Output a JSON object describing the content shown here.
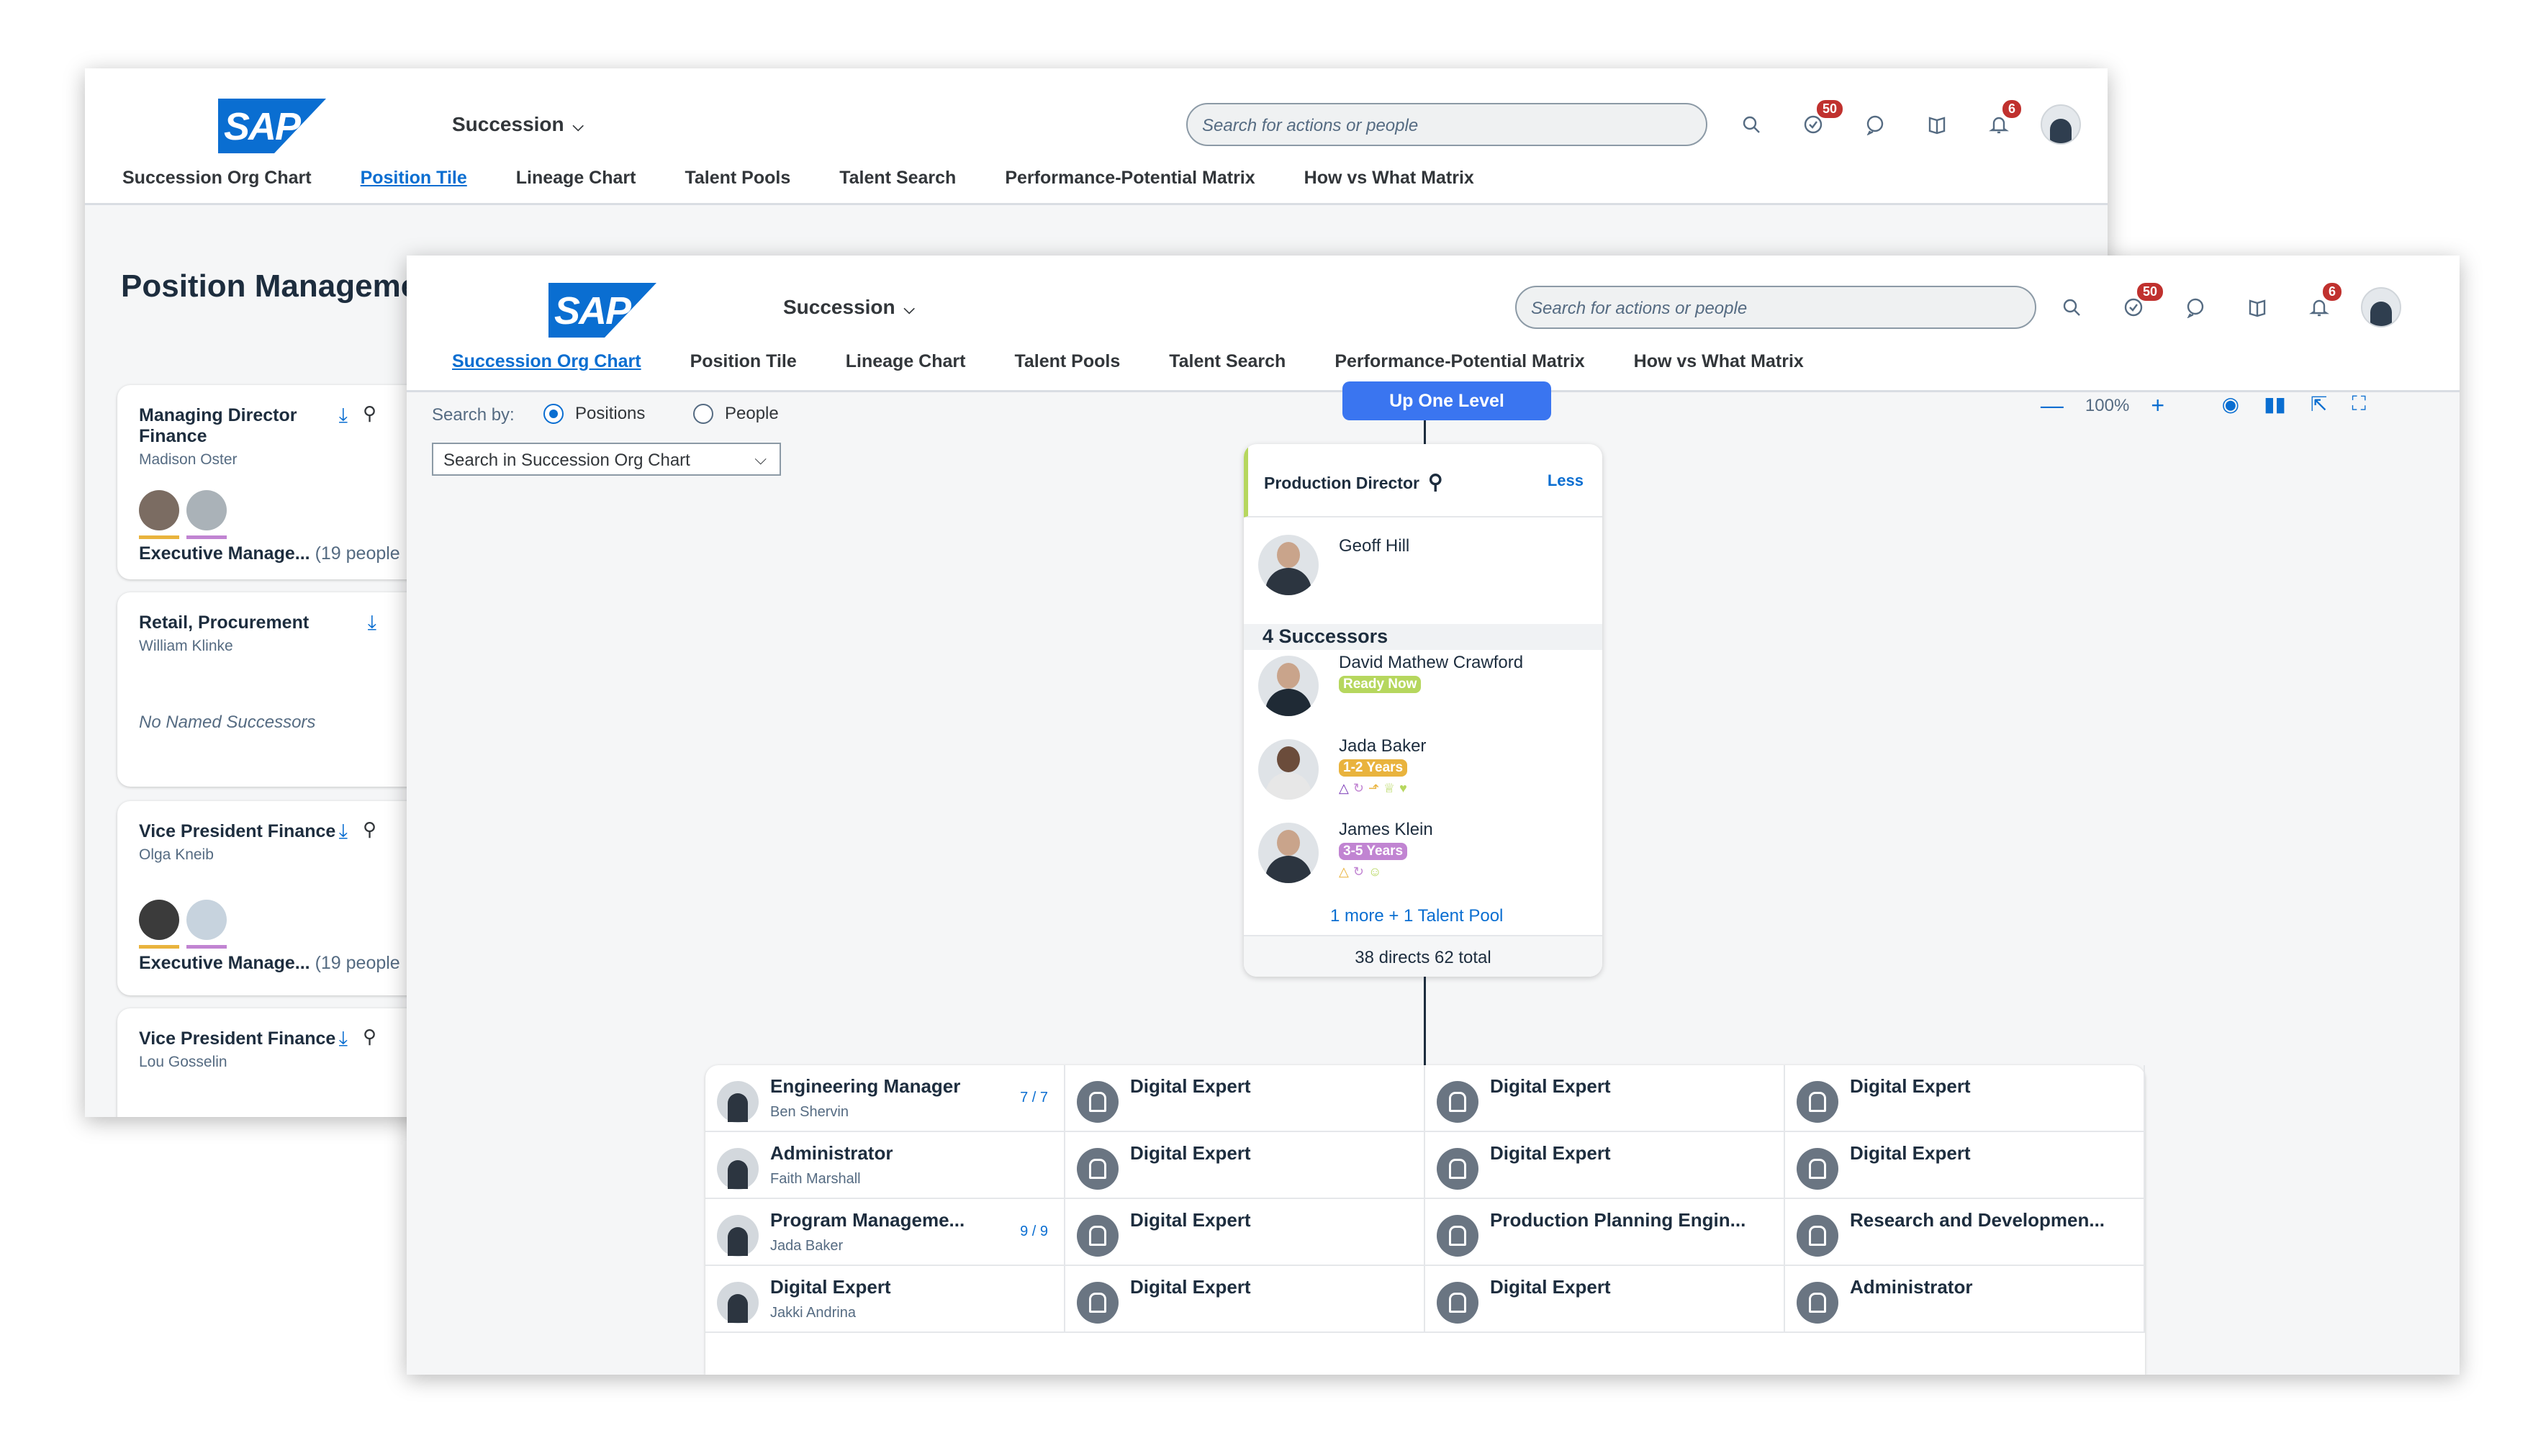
{
  "back": {
    "logo": "SAP",
    "app_menu": "Succession",
    "search_placeholder": "Search for actions or people",
    "badge_tasks": "50",
    "badge_notifications": "6",
    "tabs": [
      "Succession Org Chart",
      "Position Tile",
      "Lineage Chart",
      "Talent Pools",
      "Talent Search",
      "Performance-Potential Matrix",
      "How vs What Matrix"
    ],
    "selected_tab": "Position Tile",
    "page_title": "Position Manageme",
    "tiles": [
      {
        "title": "Managing Director Finance",
        "title2": "",
        "person": "Madison Oster",
        "pool": "Executive Manage...",
        "count": "(19 people"
      },
      {
        "title": "Retail, Procurement",
        "person": "William Klinke",
        "note": "No Named Successors"
      },
      {
        "title": "Vice President Finance",
        "person": "Olga Kneib",
        "pool": "Executive Manage...",
        "count": "(19 people"
      },
      {
        "title": "Vice President Finance",
        "person": "Lou Gosselin"
      }
    ]
  },
  "front": {
    "logo": "SAP",
    "app_menu": "Succession",
    "search_placeholder": "Search for actions or people",
    "badge_tasks": "50",
    "badge_notifications": "6",
    "tabs": [
      "Succession Org Chart",
      "Position Tile",
      "Lineage Chart",
      "Talent Pools",
      "Talent Search",
      "Performance-Potential Matrix",
      "How vs What Matrix"
    ],
    "selected_tab": "Succession Org Chart",
    "search_by": "Search by:",
    "radio_positions": "Positions",
    "radio_people": "People",
    "org_search": "Search in Succession Org Chart",
    "up_one_level": "Up One Level",
    "zoom": "100%",
    "card": {
      "position": "Production Director",
      "less": "Less",
      "incumbent": "Geoff Hill",
      "successors_header": "4 Successors",
      "successors": [
        {
          "name": "David Mathew Crawford",
          "readiness": "Ready Now"
        },
        {
          "name": "Jada Baker",
          "readiness": "1-2 Years"
        },
        {
          "name": "James Klein",
          "readiness": "3-5 Years"
        }
      ],
      "more": "1 more + 1 Talent Pool",
      "footer": "38 directs 62 total"
    },
    "grid": [
      [
        {
          "title": "Engineering Manager",
          "sub": "Ben Shervin",
          "count": "7 / 7",
          "photo": true
        },
        {
          "title": "Digital Expert"
        },
        {
          "title": "Digital Expert"
        },
        {
          "title": "Digital Expert"
        }
      ],
      [
        {
          "title": "Administrator",
          "sub": "Faith Marshall",
          "photo": true
        },
        {
          "title": "Digital Expert"
        },
        {
          "title": "Digital Expert"
        },
        {
          "title": "Digital Expert"
        }
      ],
      [
        {
          "title": "Program Manageme...",
          "sub": "Jada Baker",
          "count": "9 / 9",
          "photo": true
        },
        {
          "title": "Digital Expert"
        },
        {
          "title": "Production Planning Engin..."
        },
        {
          "title": "Research and Developmen..."
        }
      ],
      [
        {
          "title": "Digital Expert",
          "sub": "Jakki Andrina",
          "photo": true
        },
        {
          "title": "Digital Expert"
        },
        {
          "title": "Digital Expert"
        },
        {
          "title": "Administrator"
        }
      ]
    ]
  }
}
